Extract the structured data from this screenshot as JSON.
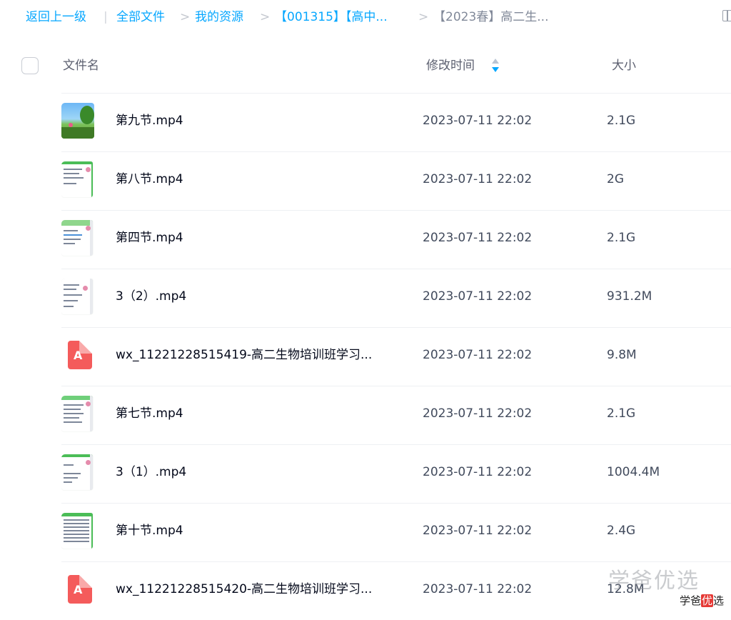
{
  "breadcrumb": {
    "back": "返回上一级",
    "items": [
      "全部文件",
      "我的资源",
      "【001315】【高中...",
      "【2023春】高二生..."
    ]
  },
  "header": {
    "col_name": "文件名",
    "col_time": "修改时间",
    "col_size": "大小"
  },
  "files": [
    {
      "name": "第九节.mp4",
      "time": "2023-07-11 22:02",
      "size": "2.1G",
      "icon": "video-thumbnail-landscape"
    },
    {
      "name": "第八节.mp4",
      "time": "2023-07-11 22:02",
      "size": "2G",
      "icon": "video-thumbnail-document"
    },
    {
      "name": "第四节.mp4",
      "time": "2023-07-11 22:02",
      "size": "2.1G",
      "icon": "video-thumbnail-document"
    },
    {
      "name": "3（2）.mp4",
      "time": "2023-07-11 22:02",
      "size": "931.2M",
      "icon": "video-thumbnail-document"
    },
    {
      "name": "wx_11221228515419-高二生物培训班学习...",
      "time": "2023-07-11 22:02",
      "size": "9.8M",
      "icon": "pdf-icon"
    },
    {
      "name": "第七节.mp4",
      "time": "2023-07-11 22:02",
      "size": "2.1G",
      "icon": "video-thumbnail-document"
    },
    {
      "name": "3（1）.mp4",
      "time": "2023-07-11 22:02",
      "size": "1004.4M",
      "icon": "video-thumbnail-document"
    },
    {
      "name": "第十节.mp4",
      "time": "2023-07-11 22:02",
      "size": "2.4G",
      "icon": "video-thumbnail-document"
    },
    {
      "name": "wx_11221228515420-高二生物培训班学习...",
      "time": "2023-07-11 22:02",
      "size": "12.8M",
      "icon": "pdf-icon"
    }
  ],
  "watermark": {
    "large": "学爸优选",
    "small_prefix": "学爸",
    "small_highlight": "优",
    "small_suffix": "选"
  },
  "colors": {
    "link": "#06a7ff",
    "pdf": "#f45b5b",
    "thumb_accent": "#4bbd57"
  }
}
